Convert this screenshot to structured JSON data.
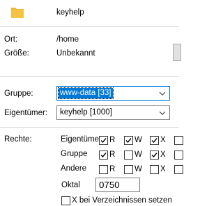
{
  "header": {
    "icon": "folder-icon",
    "name": "keyhelp"
  },
  "info": {
    "location_label": "Ort:",
    "location_value": "/home",
    "size_label": "Größe:",
    "size_value": "Unbekannt"
  },
  "ownership": {
    "group_label": "Gruppe:",
    "group_value": "www-data [33]",
    "owner_label": "Eigentümer:",
    "owner_value": "keyhelp [1000]"
  },
  "permissions": {
    "label": "Rechte:",
    "rows": [
      {
        "name": "Eigentümer",
        "r": true,
        "w": true,
        "x": true
      },
      {
        "name": "Gruppe",
        "r": true,
        "w": true,
        "x": true
      },
      {
        "name": "Andere",
        "r": false,
        "w": false,
        "x": false
      }
    ],
    "r_label": "R",
    "w_label": "W",
    "x_label": "X",
    "octal_label": "Oktal",
    "octal_value": "0750",
    "recursive_label": "X bei Verzeichnissen setzen",
    "recursive_checked": false
  },
  "colors": {
    "folder": "#f6c342",
    "selection": "#0078d7"
  }
}
